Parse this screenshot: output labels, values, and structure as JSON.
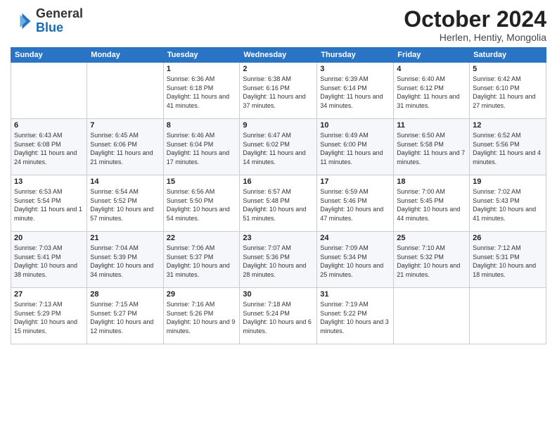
{
  "header": {
    "logo": {
      "line1": "General",
      "line2": "Blue"
    },
    "title": "October 2024",
    "location": "Herlen, Hentiy, Mongolia"
  },
  "weekdays": [
    "Sunday",
    "Monday",
    "Tuesday",
    "Wednesday",
    "Thursday",
    "Friday",
    "Saturday"
  ],
  "weeks": [
    [
      {
        "day": "",
        "info": ""
      },
      {
        "day": "",
        "info": ""
      },
      {
        "day": "1",
        "info": "Sunrise: 6:36 AM\nSunset: 6:18 PM\nDaylight: 11 hours and 41 minutes."
      },
      {
        "day": "2",
        "info": "Sunrise: 6:38 AM\nSunset: 6:16 PM\nDaylight: 11 hours and 37 minutes."
      },
      {
        "day": "3",
        "info": "Sunrise: 6:39 AM\nSunset: 6:14 PM\nDaylight: 11 hours and 34 minutes."
      },
      {
        "day": "4",
        "info": "Sunrise: 6:40 AM\nSunset: 6:12 PM\nDaylight: 11 hours and 31 minutes."
      },
      {
        "day": "5",
        "info": "Sunrise: 6:42 AM\nSunset: 6:10 PM\nDaylight: 11 hours and 27 minutes."
      }
    ],
    [
      {
        "day": "6",
        "info": "Sunrise: 6:43 AM\nSunset: 6:08 PM\nDaylight: 11 hours and 24 minutes."
      },
      {
        "day": "7",
        "info": "Sunrise: 6:45 AM\nSunset: 6:06 PM\nDaylight: 11 hours and 21 minutes."
      },
      {
        "day": "8",
        "info": "Sunrise: 6:46 AM\nSunset: 6:04 PM\nDaylight: 11 hours and 17 minutes."
      },
      {
        "day": "9",
        "info": "Sunrise: 6:47 AM\nSunset: 6:02 PM\nDaylight: 11 hours and 14 minutes."
      },
      {
        "day": "10",
        "info": "Sunrise: 6:49 AM\nSunset: 6:00 PM\nDaylight: 11 hours and 11 minutes."
      },
      {
        "day": "11",
        "info": "Sunrise: 6:50 AM\nSunset: 5:58 PM\nDaylight: 11 hours and 7 minutes."
      },
      {
        "day": "12",
        "info": "Sunrise: 6:52 AM\nSunset: 5:56 PM\nDaylight: 11 hours and 4 minutes."
      }
    ],
    [
      {
        "day": "13",
        "info": "Sunrise: 6:53 AM\nSunset: 5:54 PM\nDaylight: 11 hours and 1 minute."
      },
      {
        "day": "14",
        "info": "Sunrise: 6:54 AM\nSunset: 5:52 PM\nDaylight: 10 hours and 57 minutes."
      },
      {
        "day": "15",
        "info": "Sunrise: 6:56 AM\nSunset: 5:50 PM\nDaylight: 10 hours and 54 minutes."
      },
      {
        "day": "16",
        "info": "Sunrise: 6:57 AM\nSunset: 5:48 PM\nDaylight: 10 hours and 51 minutes."
      },
      {
        "day": "17",
        "info": "Sunrise: 6:59 AM\nSunset: 5:46 PM\nDaylight: 10 hours and 47 minutes."
      },
      {
        "day": "18",
        "info": "Sunrise: 7:00 AM\nSunset: 5:45 PM\nDaylight: 10 hours and 44 minutes."
      },
      {
        "day": "19",
        "info": "Sunrise: 7:02 AM\nSunset: 5:43 PM\nDaylight: 10 hours and 41 minutes."
      }
    ],
    [
      {
        "day": "20",
        "info": "Sunrise: 7:03 AM\nSunset: 5:41 PM\nDaylight: 10 hours and 38 minutes."
      },
      {
        "day": "21",
        "info": "Sunrise: 7:04 AM\nSunset: 5:39 PM\nDaylight: 10 hours and 34 minutes."
      },
      {
        "day": "22",
        "info": "Sunrise: 7:06 AM\nSunset: 5:37 PM\nDaylight: 10 hours and 31 minutes."
      },
      {
        "day": "23",
        "info": "Sunrise: 7:07 AM\nSunset: 5:36 PM\nDaylight: 10 hours and 28 minutes."
      },
      {
        "day": "24",
        "info": "Sunrise: 7:09 AM\nSunset: 5:34 PM\nDaylight: 10 hours and 25 minutes."
      },
      {
        "day": "25",
        "info": "Sunrise: 7:10 AM\nSunset: 5:32 PM\nDaylight: 10 hours and 21 minutes."
      },
      {
        "day": "26",
        "info": "Sunrise: 7:12 AM\nSunset: 5:31 PM\nDaylight: 10 hours and 18 minutes."
      }
    ],
    [
      {
        "day": "27",
        "info": "Sunrise: 7:13 AM\nSunset: 5:29 PM\nDaylight: 10 hours and 15 minutes."
      },
      {
        "day": "28",
        "info": "Sunrise: 7:15 AM\nSunset: 5:27 PM\nDaylight: 10 hours and 12 minutes."
      },
      {
        "day": "29",
        "info": "Sunrise: 7:16 AM\nSunset: 5:26 PM\nDaylight: 10 hours and 9 minutes."
      },
      {
        "day": "30",
        "info": "Sunrise: 7:18 AM\nSunset: 5:24 PM\nDaylight: 10 hours and 6 minutes."
      },
      {
        "day": "31",
        "info": "Sunrise: 7:19 AM\nSunset: 5:22 PM\nDaylight: 10 hours and 3 minutes."
      },
      {
        "day": "",
        "info": ""
      },
      {
        "day": "",
        "info": ""
      }
    ]
  ]
}
